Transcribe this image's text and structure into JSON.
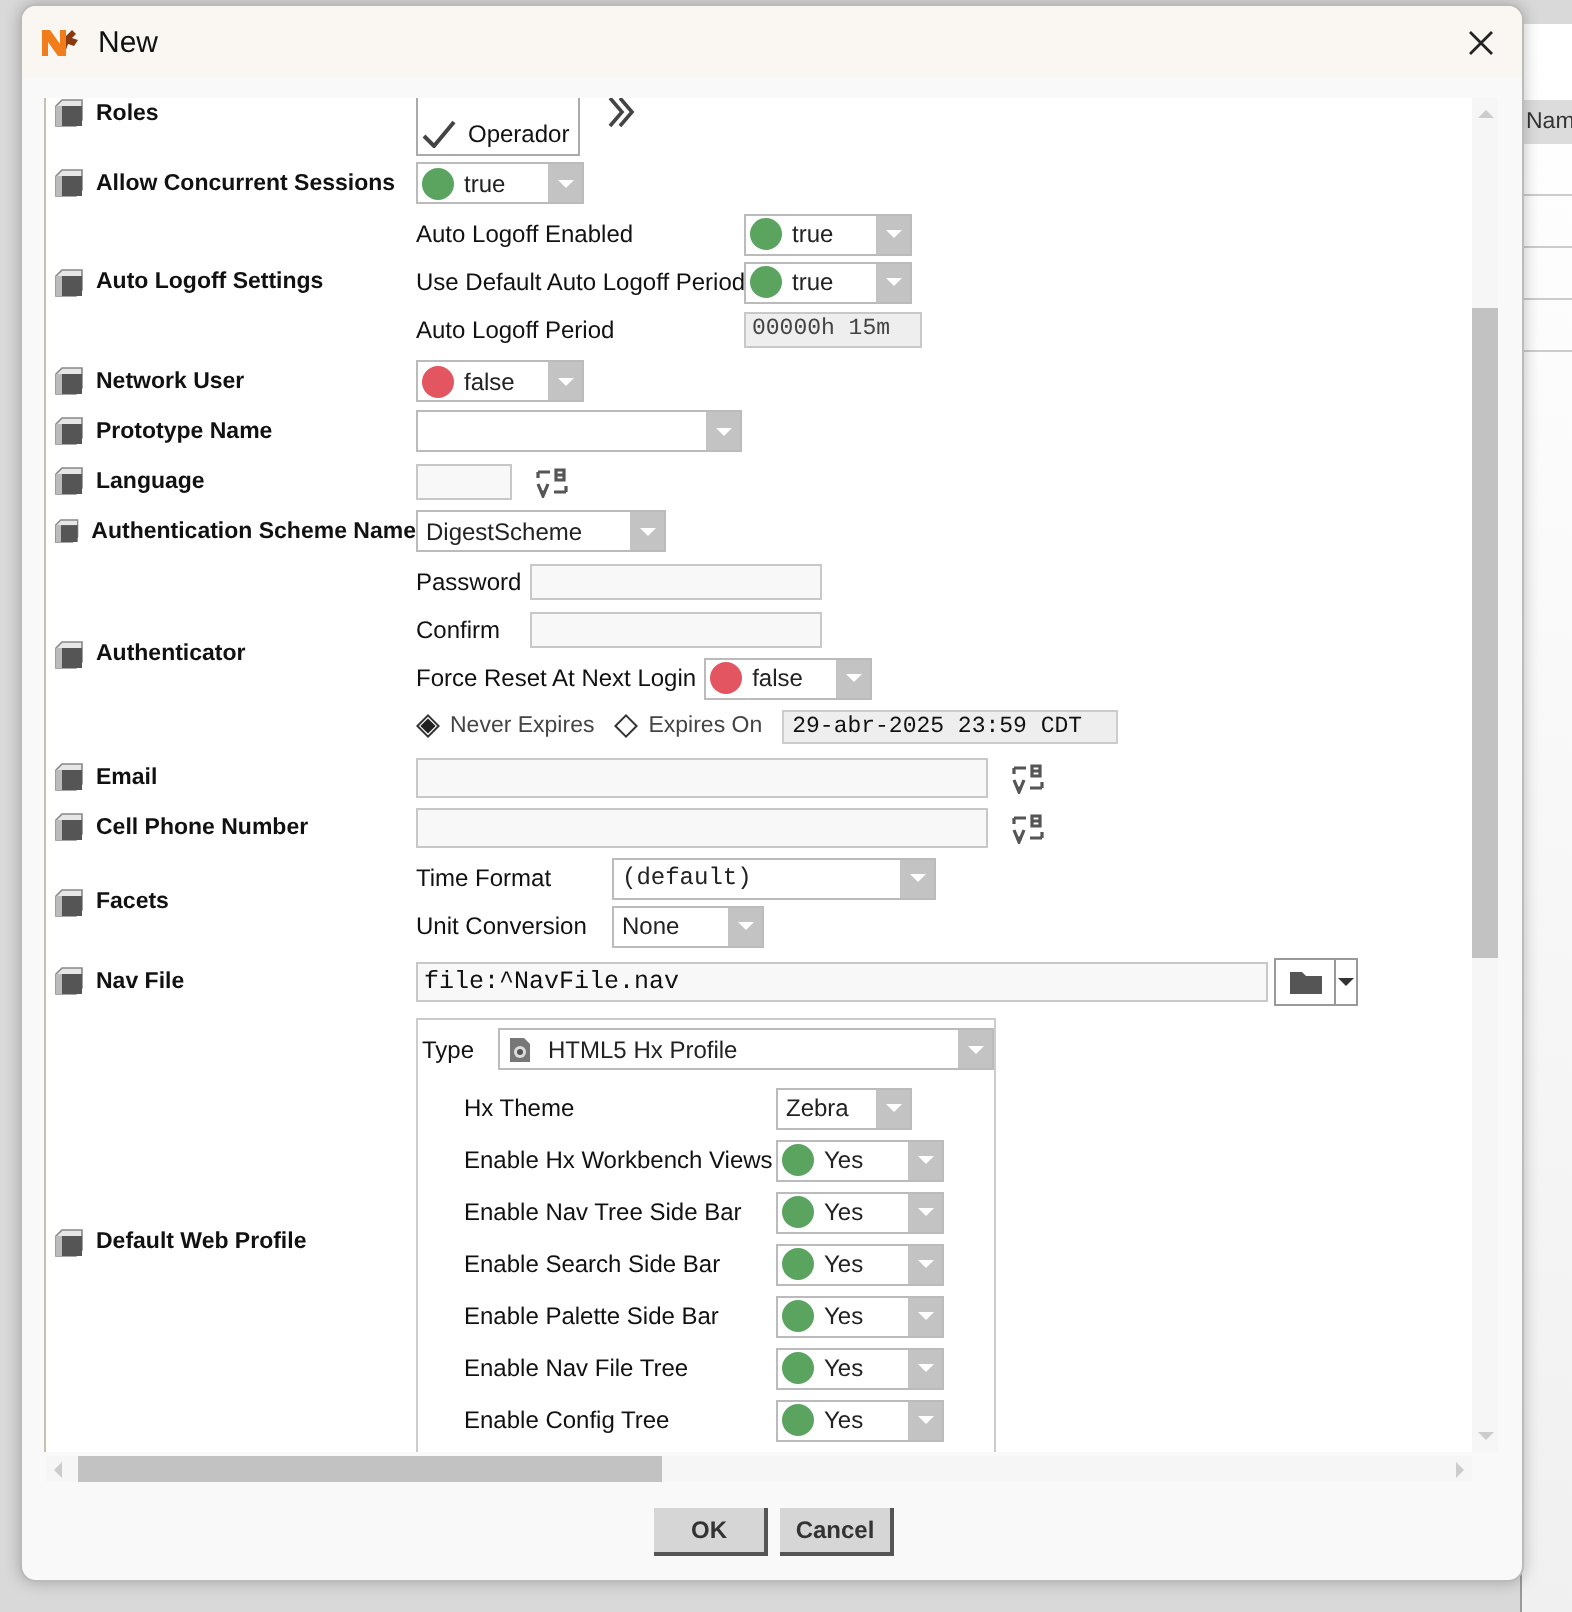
{
  "window": {
    "title": "New"
  },
  "background": {
    "column_1": "Nam"
  },
  "fields": [
    {
      "kind": "roles",
      "label": "Roles",
      "options": [
        {
          "label": "Operador",
          "checked": true
        }
      ]
    },
    {
      "kind": "bool",
      "label": "Allow Concurrent Sessions",
      "value": "true",
      "on": true
    },
    {
      "kind": "group",
      "label": "Auto Logoff Settings",
      "items": [
        {
          "kind": "bool",
          "label": "Auto Logoff Enabled",
          "value": "true",
          "on": true
        },
        {
          "kind": "bool",
          "label": "Use Default Auto Logoff Period",
          "value": "true",
          "on": true
        },
        {
          "kind": "display",
          "label": "Auto Logoff Period",
          "value": "00000h 15m"
        }
      ]
    },
    {
      "kind": "bool",
      "label": "Network User",
      "value": "false",
      "on": false
    },
    {
      "kind": "select",
      "label": "Prototype Name"
    },
    {
      "kind": "lexicon",
      "label": "Language"
    },
    {
      "kind": "select",
      "label": "Authentication Scheme Name",
      "value": "DigestScheme"
    },
    {
      "kind": "group",
      "label": "Authenticator",
      "items": [
        {
          "kind": "input",
          "label": "Password"
        },
        {
          "kind": "input",
          "label": "Confirm"
        },
        {
          "kind": "bool",
          "label": "Force Reset At Next Login",
          "value": "false",
          "on": false
        },
        {
          "kind": "expiry",
          "options": [
            {
              "label": "Never Expires",
              "selected": true
            },
            {
              "label": "Expires On",
              "selected": false
            }
          ],
          "date": "29-abr-2025 23:59 CDT"
        }
      ]
    },
    {
      "kind": "string",
      "label": "Email"
    },
    {
      "kind": "string",
      "label": "Cell Phone Number"
    },
    {
      "kind": "group",
      "label": "Facets",
      "items": [
        {
          "kind": "select",
          "label": "Time Format",
          "value": "(default)"
        },
        {
          "kind": "select",
          "label": "Unit Conversion",
          "value": "None"
        }
      ]
    },
    {
      "kind": "file",
      "label": "Nav File",
      "value": "file:^NavFile.nav"
    },
    {
      "kind": "profile",
      "label": "Default Web Profile",
      "type_label": "Type",
      "type_value": "HTML5 Hx Profile",
      "items": [
        {
          "kind": "select",
          "label": "Hx Theme",
          "value": "Zebra"
        },
        {
          "kind": "bool",
          "label": "Enable Hx Workbench Views",
          "value": "Yes",
          "on": true
        },
        {
          "kind": "bool",
          "label": "Enable Nav Tree Side Bar",
          "value": "Yes",
          "on": true
        },
        {
          "kind": "bool",
          "label": "Enable Search Side Bar",
          "value": "Yes",
          "on": true
        },
        {
          "kind": "bool",
          "label": "Enable Palette Side Bar",
          "value": "Yes",
          "on": true
        },
        {
          "kind": "bool",
          "label": "Enable Nav File Tree",
          "value": "Yes",
          "on": true
        },
        {
          "kind": "bool",
          "label": "Enable Config Tree",
          "value": "Yes",
          "on": true
        }
      ]
    }
  ],
  "buttons": [
    {
      "label": "OK"
    },
    {
      "label": "Cancel"
    }
  ]
}
